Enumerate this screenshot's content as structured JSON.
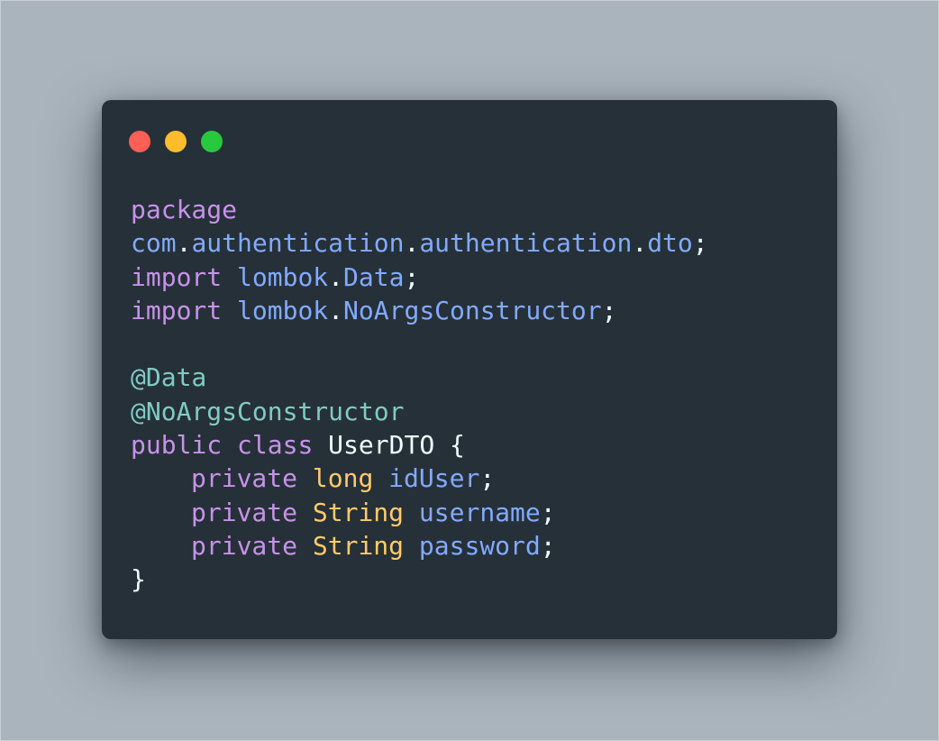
{
  "window": {
    "controls": {
      "close_color": "#ff5f56",
      "minimize_color": "#ffbd2e",
      "maximize_color": "#27c93f"
    }
  },
  "code": {
    "package_keyword": "package",
    "package_path": [
      {
        "part": "com",
        "sep": "."
      },
      {
        "part": "authentication",
        "sep": "."
      },
      {
        "part": "authentication",
        "sep": "."
      },
      {
        "part": "dto",
        "sep": ";"
      }
    ],
    "imports": [
      {
        "keyword": "import",
        "pkg": "lombok",
        "dot": ".",
        "name": "Data",
        "end": ";"
      },
      {
        "keyword": "import",
        "pkg": "lombok",
        "dot": ".",
        "name": "NoArgsConstructor",
        "end": ";"
      }
    ],
    "annotations": [
      "@Data",
      "@NoArgsConstructor"
    ],
    "class_decl": {
      "modifier": "public",
      "keyword": "class",
      "name": "UserDTO",
      "open_brace": "{"
    },
    "fields": [
      {
        "modifier": "private",
        "type": "long",
        "name": "idUser",
        "end": ";"
      },
      {
        "modifier": "private",
        "type": "String",
        "name": "username",
        "end": ";"
      },
      {
        "modifier": "private",
        "type": "String",
        "name": "password",
        "end": ";"
      }
    ],
    "close_brace": "}"
  }
}
